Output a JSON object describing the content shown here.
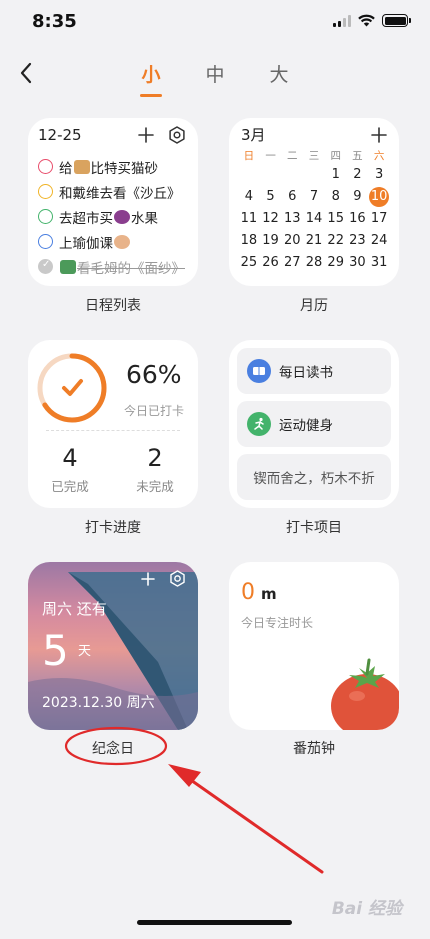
{
  "status_bar": {
    "time": "8:35"
  },
  "nav": {
    "tabs": [
      {
        "label": "小",
        "active": true
      },
      {
        "label": "中",
        "active": false
      },
      {
        "label": "大",
        "active": false
      }
    ]
  },
  "widgets": {
    "schedule": {
      "date": "12-25",
      "caption": "日程列表",
      "items": [
        {
          "text_before": "给",
          "text_after": "比特买猫砂",
          "circle_color": "#e84d6b",
          "done": false
        },
        {
          "text_before": "和戴维去看《沙丘》",
          "text_after": "",
          "circle_color": "#f0b428",
          "done": false
        },
        {
          "text_before": "去超市买",
          "text_after": "水果",
          "circle_color": "#43b36b",
          "done": false
        },
        {
          "text_before": "上瑜伽课",
          "text_after": "",
          "circle_color": "#4a7fe0",
          "done": false
        },
        {
          "text_before": "看毛姆的《面纱》",
          "text_after": "",
          "circle_color": "#c9c9c9",
          "done": true
        }
      ]
    },
    "calendar": {
      "month": "3月",
      "caption": "月历",
      "weekdays": [
        "日",
        "一",
        "二",
        "三",
        "四",
        "五",
        "六"
      ],
      "today": "10",
      "days": [
        "",
        "",
        "",
        "",
        "1",
        "2",
        "3",
        "4",
        "5",
        "6",
        "7",
        "8",
        "9",
        "10",
        "11",
        "12",
        "13",
        "14",
        "15",
        "16",
        "17",
        "18",
        "19",
        "20",
        "21",
        "22",
        "23",
        "24",
        "25",
        "26",
        "27",
        "28",
        "29",
        "30",
        "31"
      ]
    },
    "progress": {
      "caption": "打卡进度",
      "percent": "66%",
      "percent_value": 0.66,
      "today_label": "今日已打卡",
      "done_count": "4",
      "done_label": "已完成",
      "todo_count": "2",
      "todo_label": "未完成",
      "accent": "#ef7d27"
    },
    "habits": {
      "caption": "打卡项目",
      "items": [
        {
          "label": "每日读书",
          "icon": "book-icon",
          "color": "#4a7fe0"
        },
        {
          "label": "运动健身",
          "icon": "running-icon",
          "color": "#43b36b"
        }
      ],
      "quote": "锲而舍之，朽木不折"
    },
    "anniversary": {
      "caption": "纪念日",
      "weekday_until": "周六 还有",
      "count": "5",
      "unit": "天",
      "date": "2023.12.30 周六"
    },
    "tomato": {
      "caption": "番茄钟",
      "value": "0",
      "unit": "m",
      "label": "今日专注时长"
    }
  },
  "annotation": {
    "color": "#e02a2a"
  },
  "watermark": "Bai 经验"
}
